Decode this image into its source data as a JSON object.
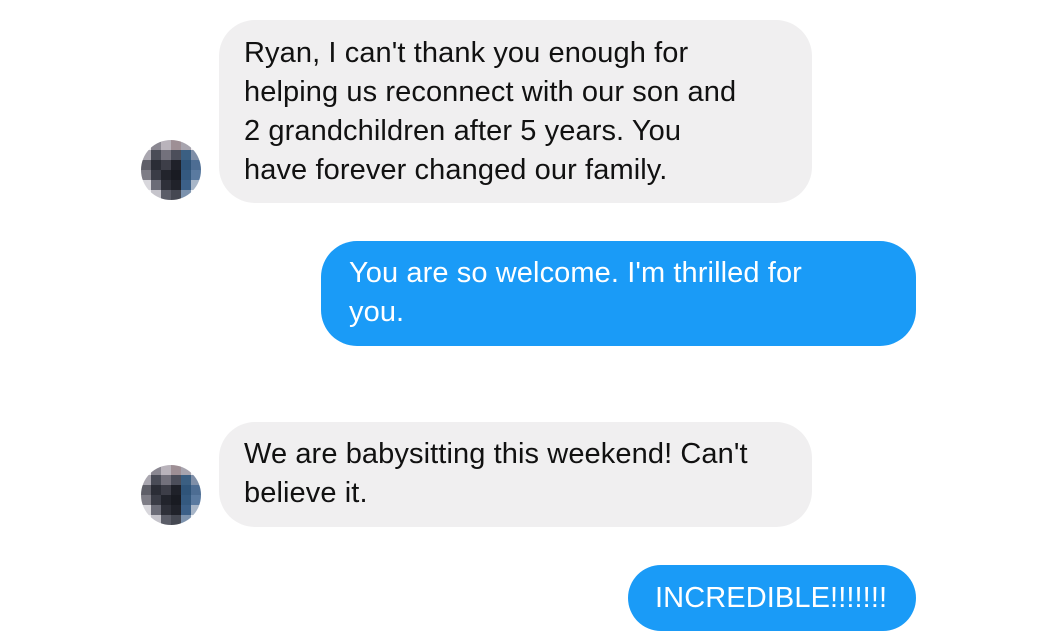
{
  "messages": [
    {
      "direction": "incoming",
      "lines": [
        "Ryan, I can't thank you enough for",
        "helping us reconnect with our son and",
        "2 grandchildren after 5 years. You",
        "have forever changed our family."
      ]
    },
    {
      "direction": "outgoing",
      "lines": [
        "You are so welcome. I'm thrilled for",
        "you."
      ]
    },
    {
      "direction": "incoming",
      "lines": [
        "We are babysitting this weekend! Can't",
        "believe it."
      ]
    },
    {
      "direction": "outgoing",
      "lines": [
        "INCREDIBLE!!!!!!!"
      ]
    }
  ],
  "avatars": [
    {
      "icon": "pixelated-avatar",
      "note": "blurred contact photo"
    },
    {
      "icon": "pixelated-avatar",
      "note": "blurred contact photo"
    }
  ],
  "colors": {
    "incoming_bubble": "#f0eff0",
    "outgoing_bubble": "#1a9bf7",
    "incoming_text": "#111111",
    "outgoing_text": "#ffffff",
    "background": "#ffffff"
  }
}
